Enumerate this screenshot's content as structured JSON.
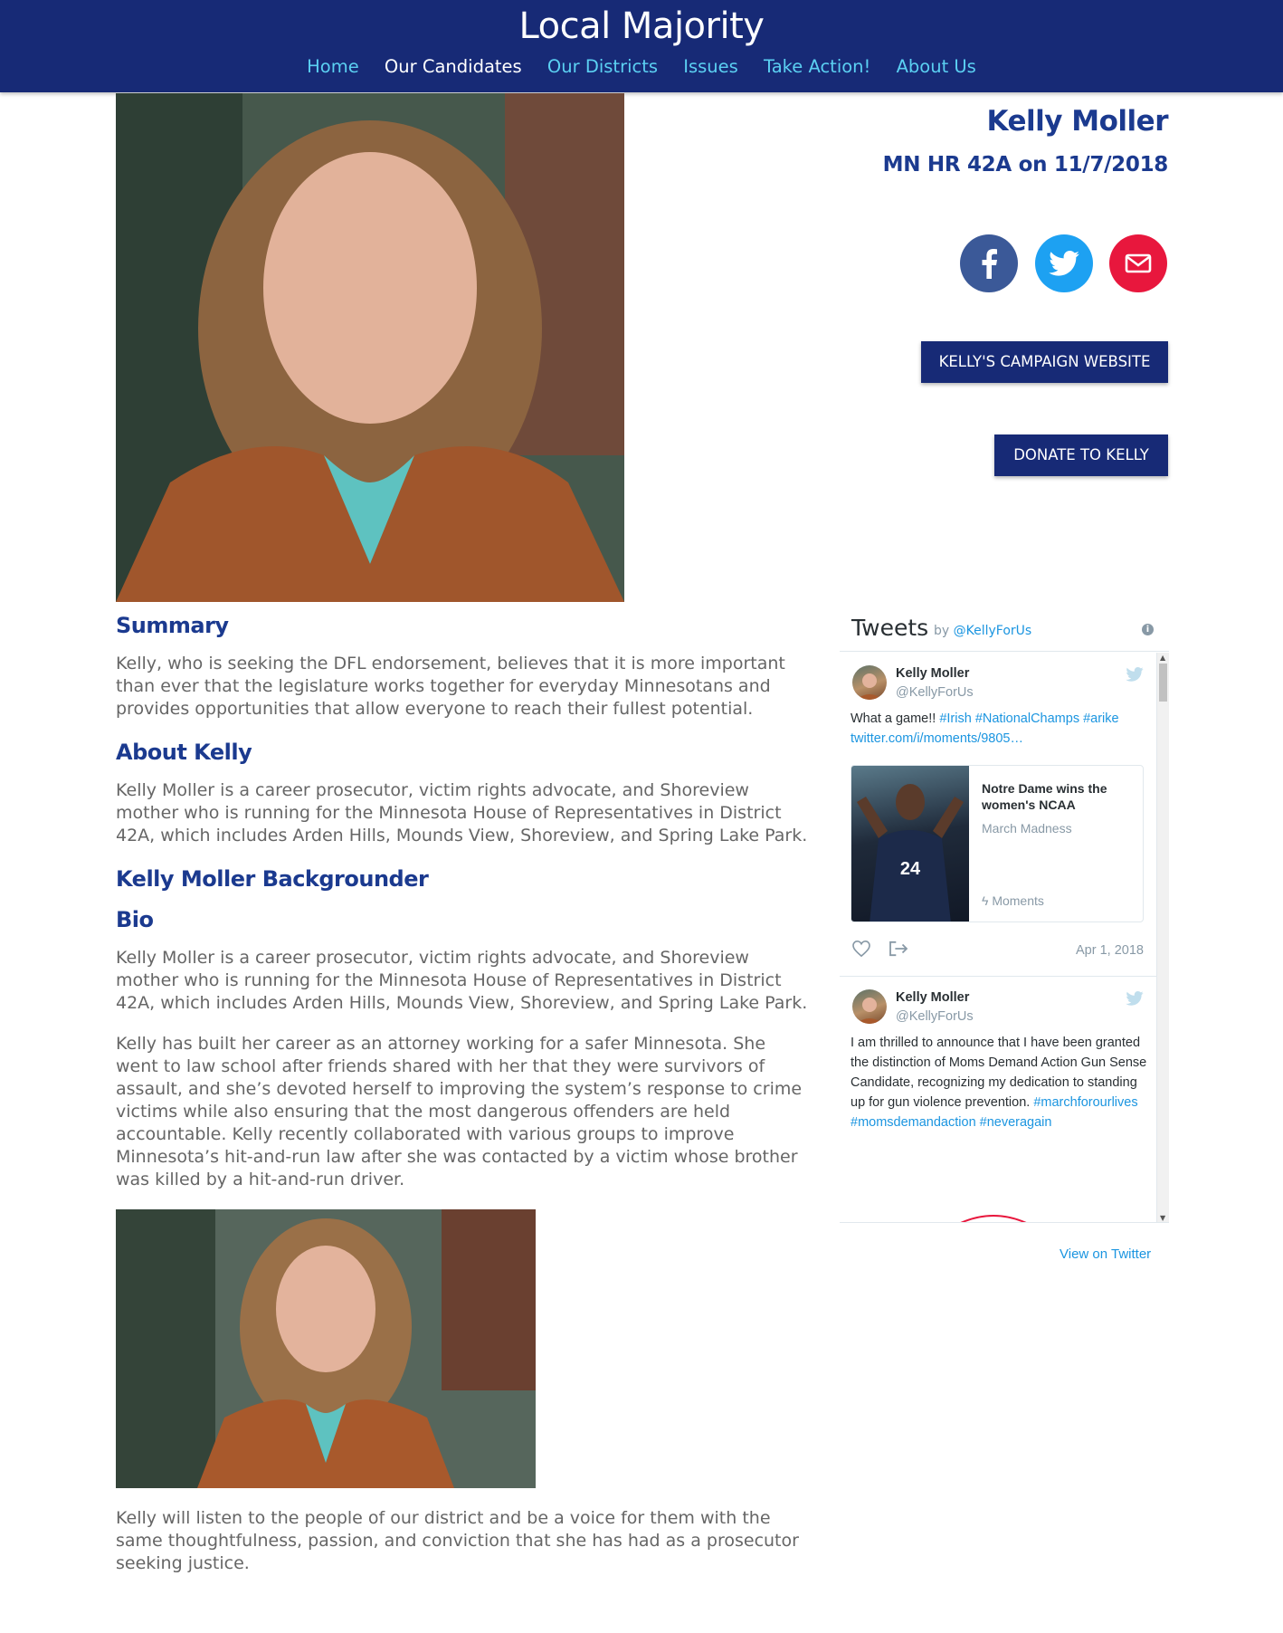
{
  "site": {
    "brand": "Local Majority",
    "nav": [
      "Home",
      "Our Candidates",
      "Our Districts",
      "Issues",
      "Take Action!",
      "About Us"
    ],
    "active_nav": "Our Candidates"
  },
  "candidate": {
    "name": "Kelly Moller",
    "race": "MN HR 42A on 11/7/2018",
    "social": [
      "facebook-icon",
      "twitter-icon",
      "email-icon"
    ],
    "campaign_button": "KELLY'S CAMPAIGN WEBSITE",
    "donate_button": "DONATE TO KELLY"
  },
  "content": {
    "summary_heading": "Summary",
    "summary_text": "Kelly, who is seeking the DFL endorsement, believes that it is more important than ever that the legislature works together for everyday Minnesotans and provides opportunities that allow everyone to reach their fullest potential.",
    "about_heading": "About Kelly",
    "about_text": "Kelly Moller is a career prosecutor, victim rights advocate, and Shoreview mother who is running for the Minnesota House of Representatives in District 42A, which includes Arden Hills, Mounds View, Shoreview, and Spring Lake Park.",
    "backgrounder_heading": "Kelly Moller Backgrounder",
    "bio_heading": "Bio",
    "bio_text_1": "Kelly Moller is a career prosecutor, victim rights advocate, and Shoreview mother who is running for the Minnesota House of Representatives in District 42A, which includes Arden Hills, Mounds View, Shoreview, and Spring Lake Park.",
    "bio_text_2": "Kelly has built her career as an attorney working for a safer Minnesota. She went to law school after friends shared with her that they were survivors of assault, and she’s devoted herself to improving the system’s response to crime victims while also ensuring that the most dangerous offenders are held accountable. Kelly recently collaborated with various groups to improve Minnesota’s hit-and-run law after she was contacted by a victim whose brother was killed by a hit-and-run driver.",
    "closing_text": "Kelly will listen to the people of our district and be a voice for them with the same thoughtfulness, passion, and conviction that she has had as a prosecutor seeking justice."
  },
  "twitter": {
    "title": "Tweets",
    "by_label": "by",
    "handle": "@KellyForUs",
    "info": "i",
    "tweets": [
      {
        "name": "Kelly Moller",
        "handle": "@KellyForUs",
        "text_plain": "What a game!!",
        "text_links": "#Irish #NationalChamps #arike",
        "url": "twitter.com/i/moments/9805…",
        "card_title": "Notre Dame wins the women's NCAA",
        "card_subtitle": "March Madness",
        "card_footer": "Moments",
        "date": "Apr 1, 2018"
      },
      {
        "name": "Kelly Moller",
        "handle": "@KellyForUs",
        "text_plain": "I am thrilled to announce that I have been granted the distinction of Moms Demand Action Gun Sense Candidate, recognizing my dedication to standing up for gun violence prevention.",
        "text_links": "#marchforourlives #momsdemandaction #neveragain"
      }
    ],
    "view_on_twitter": "View on Twitter"
  }
}
